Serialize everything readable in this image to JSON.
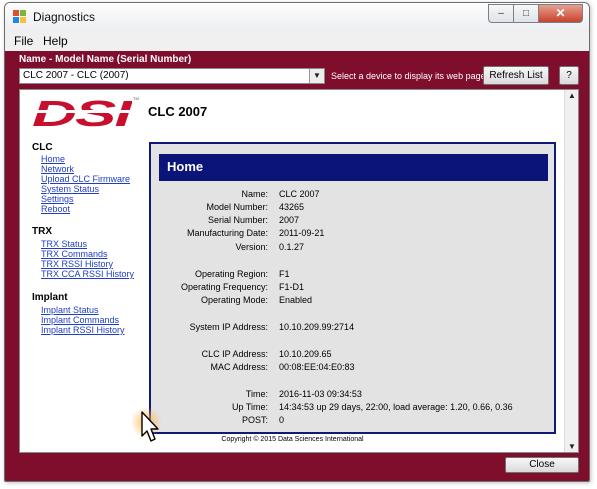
{
  "window": {
    "title": "Diagnostics",
    "controls": {
      "minimize": "–",
      "maximize": "□",
      "close": "✕"
    }
  },
  "menu": {
    "items": [
      "File",
      "Help"
    ]
  },
  "toolbar": {
    "device_label": "Name - Model Name (Serial Number)",
    "device_selected": "CLC 2007 - CLC (2007)",
    "hint": "Select a device to display its web page",
    "refresh_label": "Refresh List",
    "help_label": "?"
  },
  "page": {
    "logo_text": "DSI",
    "logo_tm": "TM",
    "logo_color": "#c8102e",
    "title": "CLC 2007",
    "nav": [
      {
        "section": "CLC",
        "links": [
          "Home",
          "Network",
          "Upload CLC Firmware",
          "System Status",
          "Settings",
          "Reboot"
        ]
      },
      {
        "section": "TRX",
        "links": [
          "TRX Status",
          "TRX Commands",
          "TRX RSSI History",
          "TRX CCA RSSI History"
        ]
      },
      {
        "section": "Implant",
        "links": [
          "Implant Status",
          "Implant Commands",
          "Implant RSSI History"
        ]
      }
    ],
    "panel": {
      "title": "Home",
      "rows": [
        {
          "label": "Name:",
          "value": "CLC 2007"
        },
        {
          "label": "Model Number:",
          "value": "43265"
        },
        {
          "label": "Serial Number:",
          "value": "2007"
        },
        {
          "label": "Manufacturing Date:",
          "value": "2011-09-21"
        },
        {
          "label": "Version:",
          "value": "0.1.27"
        },
        {
          "label": "Operating Region:",
          "value": "F1"
        },
        {
          "label": "Operating Frequency:",
          "value": "F1-D1"
        },
        {
          "label": "Operating Mode:",
          "value": "Enabled"
        },
        {
          "label": "System IP Address:",
          "value": "10.10.209.99:2714"
        },
        {
          "label": "CLC IP Address:",
          "value": "10.10.209.65"
        },
        {
          "label": "MAC Address:",
          "value": "00:08:EE:04:E0:83"
        },
        {
          "label": "Time:",
          "value": "2016-11-03 09:34:53"
        },
        {
          "label": "Up Time:",
          "value": "14:34:53 up 29 days, 22:00, load average: 1.20, 0.66, 0.36"
        },
        {
          "label": "POST:",
          "value": "0"
        }
      ]
    },
    "copyright": "Copyright © 2015 Data Sciences International"
  },
  "footer": {
    "close_label": "Close"
  },
  "colors": {
    "client_background": "#7f0d2c",
    "panel_header": "#0b1478",
    "link": "#1f3ec5"
  }
}
